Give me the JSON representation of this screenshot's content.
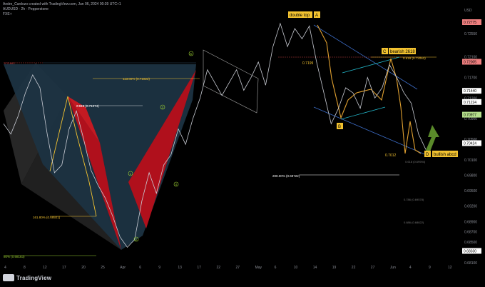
{
  "header": {
    "line1": "Andre_Cardozo created with TradingView.com, Jun 06, 2024 00:39 UTC+1",
    "line2": "AUDUSD · 2h · Pepperstone",
    "line3": "FXE+"
  },
  "brand": {
    "name": "TradingView"
  },
  "colors": {
    "background": "#000000",
    "candle": "#c9ccd4",
    "pattern_red": "#c1121f",
    "pattern_teal": "#1c3342",
    "pattern_grey": "#3a3a3a",
    "yellow": "#f2c230",
    "orange_line": "#e0a030",
    "blue_line": "#3d6ec9",
    "cyan_line": "#22b5c8",
    "green_arrow": "#5a8a2a",
    "axis_text": "#8a8d96",
    "badge_red": "#f08080",
    "badge_white": "#ffffff",
    "badge_green": "#b6e08c"
  },
  "chart_data": {
    "type": "line",
    "title": "AUDUSD · 2h",
    "ylim": [
      0.681,
      0.729
    ],
    "y_axis_label": "USD",
    "y_ticks": [
      "0.72775",
      "0.72550",
      "0.72100",
      "0.71700",
      "0.71300",
      "0.70900",
      "0.70500",
      "0.70100",
      "0.69800",
      "0.69500",
      "0.69200",
      "0.68900",
      "0.68700",
      "0.68500",
      "0.68100"
    ],
    "x_ticks": [
      "4",
      "8",
      "12",
      "17",
      "20",
      "25",
      "Apr",
      "6",
      "9",
      "13",
      "17",
      "22",
      "27",
      "May",
      "6",
      "10",
      "14",
      "19",
      "22",
      "27",
      "Jun",
      "4",
      "9",
      "12"
    ],
    "price_badges": [
      {
        "value": "0.72775",
        "style": "red"
      },
      {
        "value": "0.72005",
        "style": "red"
      },
      {
        "value": "0.71440",
        "style": "white"
      },
      {
        "value": "0.71224",
        "style": "white"
      },
      {
        "value": "0.70977",
        "style": "green"
      },
      {
        "value": "0.70424",
        "style": "white"
      },
      {
        "value": "0.68330",
        "style": "white"
      }
    ],
    "series": [
      {
        "values": [
          0.708,
          0.706,
          0.7095,
          0.714,
          0.7175,
          0.715,
          0.706,
          0.6985,
          0.7,
          0.707,
          0.7105,
          0.705,
          0.699,
          0.696,
          0.6935,
          0.69,
          0.686,
          0.684,
          0.6855,
          0.693,
          0.6985,
          0.6945,
          0.7,
          0.702,
          0.707,
          0.704,
          0.709,
          0.713,
          0.7185,
          0.716,
          0.7135,
          0.716,
          0.7185,
          0.7145,
          0.717,
          0.72,
          0.7155,
          0.723,
          0.7275,
          0.723,
          0.7265,
          0.7245,
          0.727,
          0.72,
          0.714,
          0.708,
          0.711,
          0.715,
          0.714,
          0.711,
          0.717,
          0.713,
          0.715,
          0.7195,
          0.717,
          0.714,
          0.712,
          0.706,
          0.703
        ]
      }
    ],
    "annotations": {
      "double_top": "double top",
      "bearish": "bearish 2618",
      "bullish": "bullish abcd",
      "point_a": "A",
      "point_b": "B",
      "point_c": "C",
      "point_d": "D",
      "fib_618_top": "0.618 (0.72063)",
      "fib_618_left": "0.618 (0.71074)",
      "fib_113": "113.00% (0.71822)",
      "fib_1618": "161.80% (0.68921)",
      "fib_200": "200.00% (0.69722)",
      "fib_786": "0.786 (0.69578)",
      "fib_618_low": "0.618 (0.69994)",
      "fib_886": "0.886 (0.68822)",
      "fib_left_top": "0.71663",
      "fib_bottom_left": "80% (0.68183)",
      "val_7199": "0.7199",
      "val_7012": "0.7012",
      "wave_1": "1",
      "wave_2": "2",
      "wave_3": "3",
      "wave_4": "4",
      "wave_5": "5"
    }
  }
}
